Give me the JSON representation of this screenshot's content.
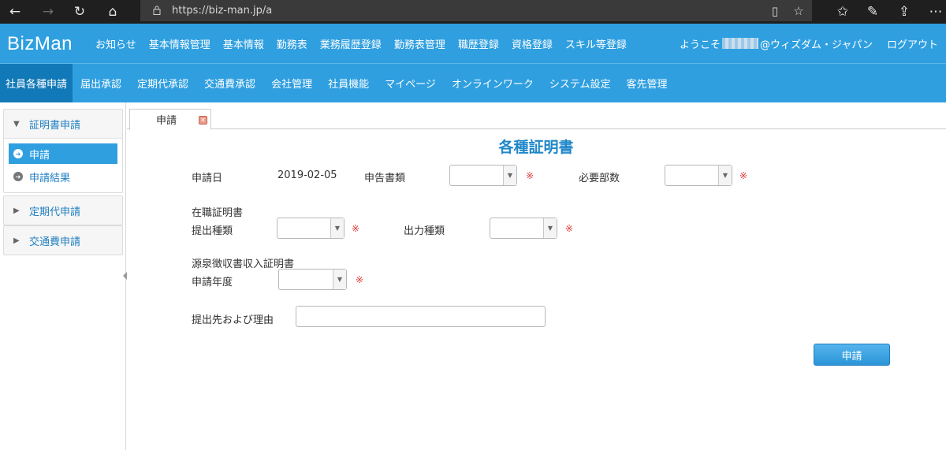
{
  "browser": {
    "url": "https://biz-man.jp/a"
  },
  "header": {
    "logo": "BizMan",
    "top_menu": [
      "お知らせ",
      "基本情報管理",
      "基本情報",
      "勤務表",
      "業務履歴登録",
      "勤務表管理",
      "職歴登録",
      "資格登録",
      "スキル等登録"
    ],
    "welcome_prefix": "ようこそ",
    "welcome_suffix": "@ウィズダム・ジャパン",
    "logout": "ログアウト"
  },
  "main_tabs": {
    "active": "社員各種申請",
    "items": [
      "届出承認",
      "定期代承認",
      "交通費承認",
      "会社管理",
      "社員機能",
      "マイページ",
      "オンラインワーク",
      "システム設定",
      "客先管理"
    ]
  },
  "sidebar": {
    "certificate_panel": "証明書申請",
    "certificate_items": [
      "申請",
      "申請結果"
    ],
    "commute_panel": "定期代申請",
    "transport_panel": "交通費申請"
  },
  "tab": {
    "label": "申請",
    "close": "✕"
  },
  "form": {
    "title": "各種証明書",
    "date_label": "申請日",
    "date_value": "2019-02-05",
    "doc_type_label": "申告書類",
    "copies_label": "必要部数",
    "employment_section": "在職証明書",
    "submit_type_label": "提出種類",
    "output_type_label": "出力種類",
    "withholding_section": "源泉徴収書収入証明書",
    "year_label": "申請年度",
    "reason_label": "提出先および理由",
    "required_mark": "※",
    "submit_button": "申請"
  }
}
